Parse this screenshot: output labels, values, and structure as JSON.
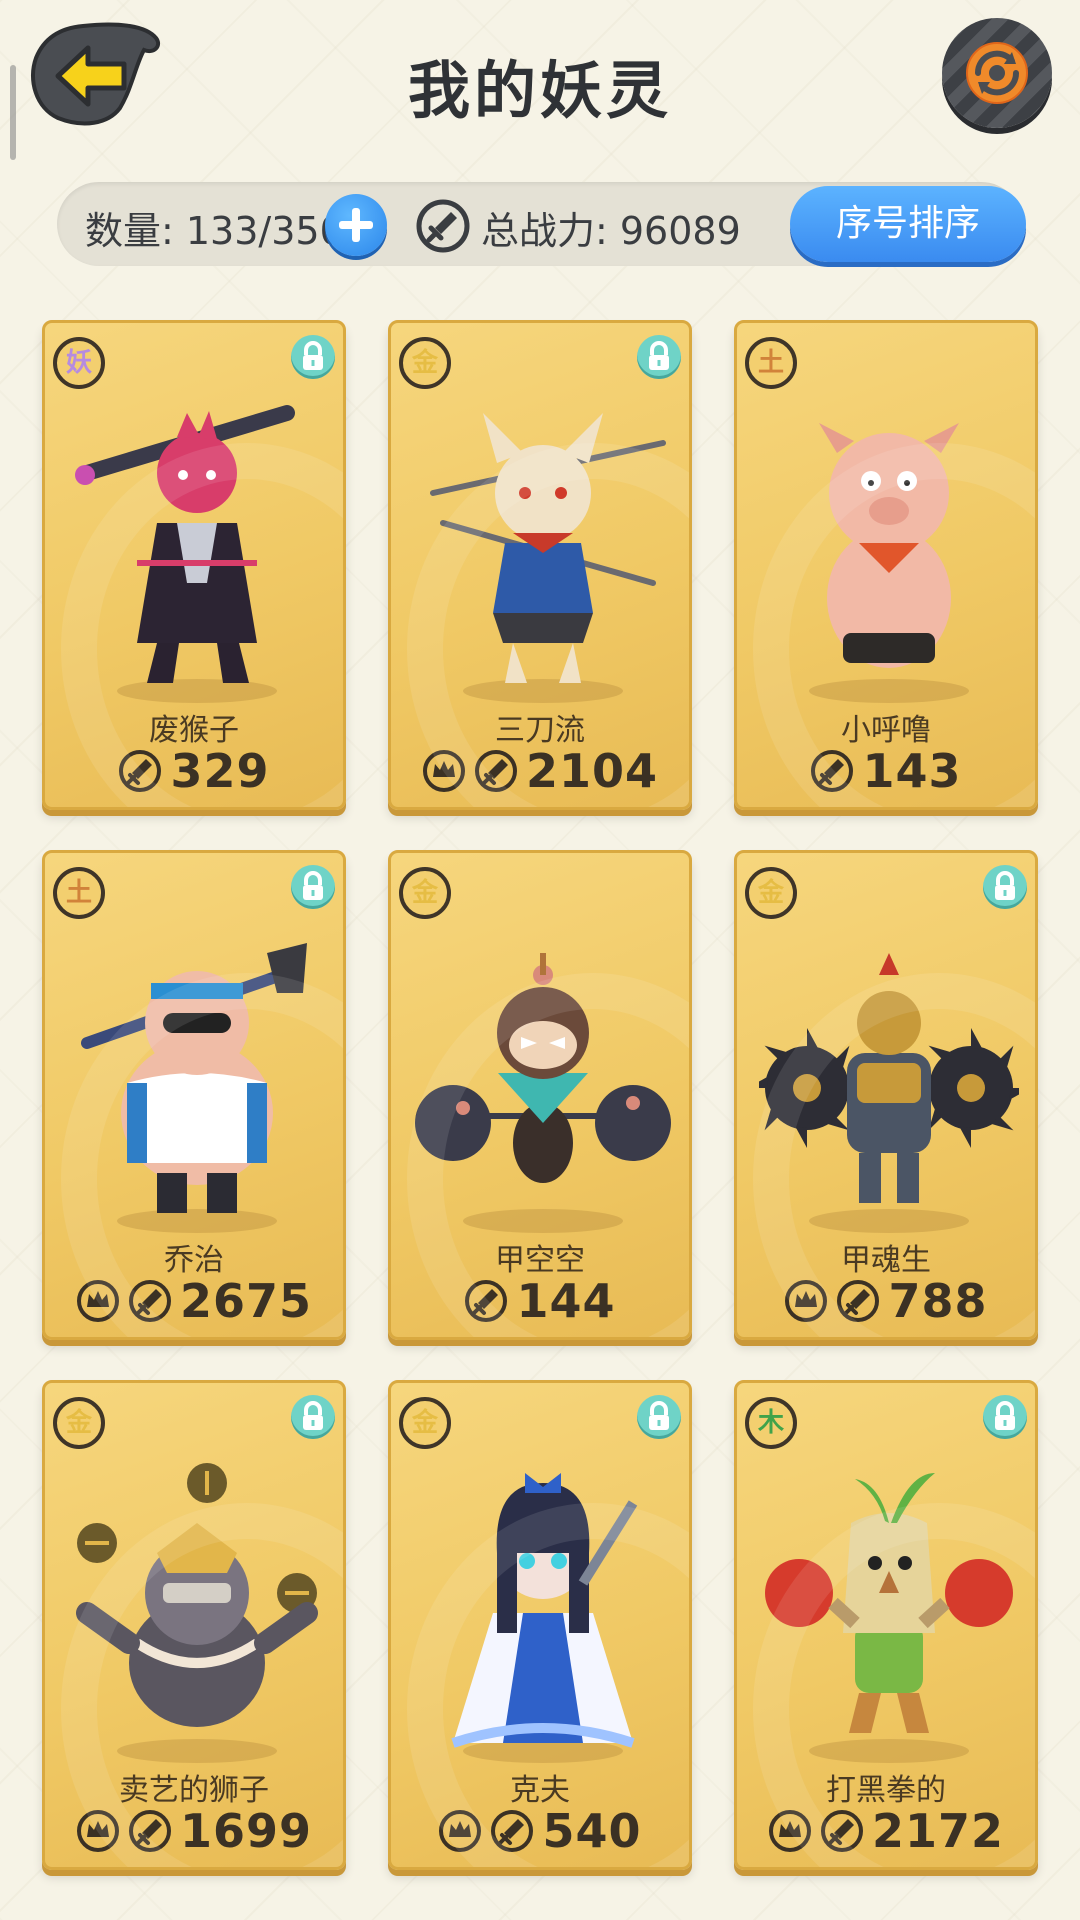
{
  "header": {
    "title": "我的妖灵",
    "back_icon": "arrow-left-icon",
    "refresh_icon": "refresh-icon"
  },
  "stats": {
    "count_text": "数量: 133/350",
    "add_icon": "plus-icon",
    "power_icon": "sword-icon",
    "total_power_text": "总战力: 96089",
    "sort_label": "序号排序"
  },
  "colors": {
    "card_gold": "#f0c965",
    "accent_blue": "#3a8bf0",
    "lock_teal": "#6fd3c7",
    "yao": "#b58be0",
    "jin": "#e6bd44",
    "tu": "#d1833a",
    "mu": "#41a34a"
  },
  "cards": [
    {
      "element": "妖",
      "element_color": "#b58be0",
      "name": "废猴子",
      "power": "329",
      "crown": false,
      "locked": true,
      "art": "red-demon-monkey",
      "body": "#2c2433",
      "accent": "#d83d6a"
    },
    {
      "element": "金",
      "element_color": "#e6bd44",
      "name": "三刀流",
      "power": "2104",
      "crown": true,
      "locked": true,
      "art": "white-fox-swordsman",
      "body": "#2e5aa8",
      "accent": "#f1e2c6"
    },
    {
      "element": "土",
      "element_color": "#d1833a",
      "name": "小呼噜",
      "power": "143",
      "crown": false,
      "locked": false,
      "art": "pink-pig",
      "body": "#f2b9a6",
      "accent": "#e1562b"
    },
    {
      "element": "土",
      "element_color": "#d1833a",
      "name": "乔治",
      "power": "2675",
      "crown": true,
      "locked": true,
      "art": "pig-warrior",
      "body": "#f0bca6",
      "accent": "#2f7ec6"
    },
    {
      "element": "金",
      "element_color": "#e6bd44",
      "name": "甲空空",
      "power": "144",
      "crown": false,
      "locked": false,
      "art": "monkey-with-bombs",
      "body": "#6b4a3a",
      "accent": "#3fb7b0"
    },
    {
      "element": "金",
      "element_color": "#e6bd44",
      "name": "甲魂生",
      "power": "788",
      "crown": true,
      "locked": true,
      "art": "armored-spike-ball",
      "body": "#4b5565",
      "accent": "#c79a3a"
    },
    {
      "element": "金",
      "element_color": "#e6bd44",
      "name": "卖艺的狮子",
      "power": "1699",
      "crown": true,
      "locked": true,
      "art": "lion-juggler",
      "body": "#5a5660",
      "accent": "#e2b64a"
    },
    {
      "element": "金",
      "element_color": "#e6bd44",
      "name": "克夫",
      "power": "540",
      "crown": true,
      "locked": true,
      "art": "blue-dress-girl",
      "body": "#f4f6ff",
      "accent": "#2f61c9"
    },
    {
      "element": "木",
      "element_color": "#41a34a",
      "name": "打黑拳的",
      "power": "2172",
      "crown": true,
      "locked": true,
      "art": "boxing-sprout",
      "body": "#e6d49a",
      "accent": "#d63b2c"
    }
  ]
}
